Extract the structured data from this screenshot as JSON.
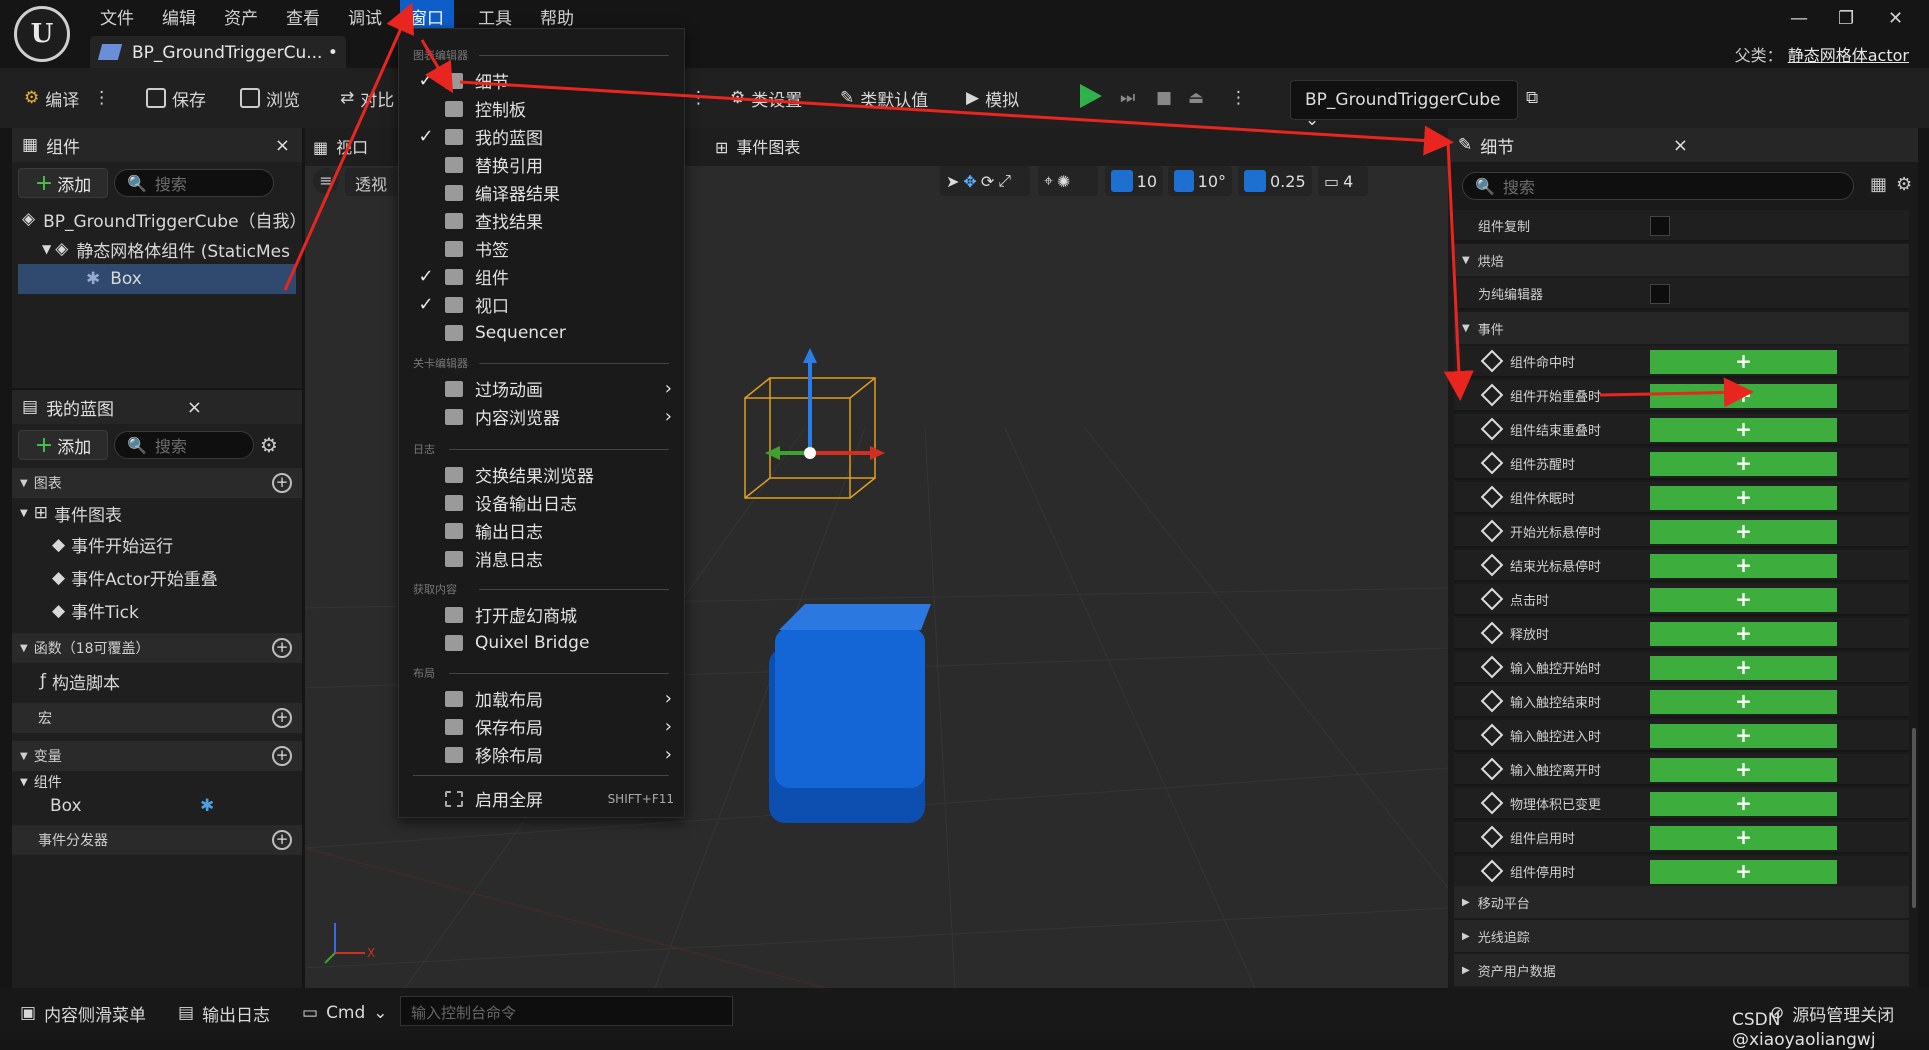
{
  "app": {
    "logo_text": "U"
  },
  "menubar": {
    "items": [
      "文件",
      "编辑",
      "资产",
      "查看",
      "调试",
      "窗口",
      "工具",
      "帮助"
    ],
    "active": "窗口"
  },
  "tab": {
    "title": "BP_GroundTriggerCu...",
    "modified": "•",
    "close": "×"
  },
  "window_controls": {
    "minimize": "—",
    "maximize": "❐",
    "close": "✕"
  },
  "parent": {
    "label": "父类：",
    "value": "静态网格体actor"
  },
  "toolbar": {
    "compile": "编译",
    "save": "保存",
    "browse": "浏览",
    "diff": "对比",
    "class_settings": "类设置",
    "class_defaults": "类默认值",
    "simulate": "模拟",
    "blueprint_dropdown": "BP_GroundTriggerCube"
  },
  "components_panel": {
    "title": "组件",
    "add": "添加",
    "search_placeholder": "搜索",
    "tree": [
      "BP_GroundTriggerCube（自我）",
      "静态网格体组件 (StaticMesh",
      "Box"
    ]
  },
  "myblueprint_panel": {
    "title": "我的蓝图",
    "add": "添加",
    "search_placeholder": "搜索",
    "graphs_label": "图表",
    "event_graph": "事件图表",
    "events": [
      "事件开始运行",
      "事件Actor开始重叠",
      "事件Tick"
    ],
    "functions_label": "函数（18可覆盖）",
    "construction_script": "构造脚本",
    "macros_label": "宏",
    "variables_label": "变量",
    "components_label": "组件",
    "component_var": "Box",
    "dispatchers_label": "事件分发器"
  },
  "viewport": {
    "tab": "视口",
    "perspective": "透视",
    "event_graph_tab": "事件图表",
    "grid": "10",
    "rotation": "10°",
    "scale": "0.25",
    "camera": "4"
  },
  "window_menu": {
    "section1": "图表编辑器",
    "items1": [
      {
        "label": "细节",
        "checked": true
      },
      {
        "label": "控制板",
        "checked": false
      },
      {
        "label": "我的蓝图",
        "checked": true
      },
      {
        "label": "替换引用",
        "checked": false
      },
      {
        "label": "编译器结果",
        "checked": false
      },
      {
        "label": "查找结果",
        "checked": false
      },
      {
        "label": "书签",
        "checked": false
      },
      {
        "label": "组件",
        "checked": true
      },
      {
        "label": "视口",
        "checked": true
      },
      {
        "label": "Sequencer",
        "checked": false
      }
    ],
    "section2": "关卡编辑器",
    "items2": [
      "过场动画",
      "内容浏览器"
    ],
    "section3": "日志",
    "items3": [
      "交换结果浏览器",
      "设备输出日志",
      "输出日志",
      "消息日志"
    ],
    "section4": "获取内容",
    "items4": [
      "打开虚幻商城",
      "Quixel Bridge"
    ],
    "section5": "布局",
    "items5": [
      "加载布局",
      "保存布局",
      "移除布局"
    ],
    "fullscreen": "启用全屏",
    "fullscreen_shortcut": "SHIFT+F11"
  },
  "details_panel": {
    "title": "细节",
    "search_placeholder": "搜索",
    "component_replication": "组件复制",
    "cooking": "烘焙",
    "editor_only": "为纯编辑器",
    "events_section": "事件",
    "events": [
      "组件命中时",
      "组件开始重叠时",
      "组件结束重叠时",
      "组件苏醒时",
      "组件休眠时",
      "开始光标悬停时",
      "结束光标悬停时",
      "点击时",
      "释放时",
      "输入触控开始时",
      "输入触控结束时",
      "输入触控进入时",
      "输入触控离开时",
      "物理体积已变更",
      "组件启用时",
      "组件停用时"
    ],
    "add_symbol": "+",
    "collapsed_sections": [
      "移动平台",
      "光线追踪",
      "资产用户数据"
    ]
  },
  "bottombar": {
    "content_drawer": "内容侧滑菜单",
    "output_log": "输出日志",
    "cmd": "Cmd",
    "cmd_placeholder": "输入控制台命令",
    "source_control": "源码管理关闭",
    "watermark": "CSDN @xiaoyaoliangwj"
  },
  "colors": {
    "accent": "#0d5ec9",
    "add_green": "#3dae3d",
    "cube_blue": "#1466d6",
    "annotation_red": "#e8261f"
  }
}
